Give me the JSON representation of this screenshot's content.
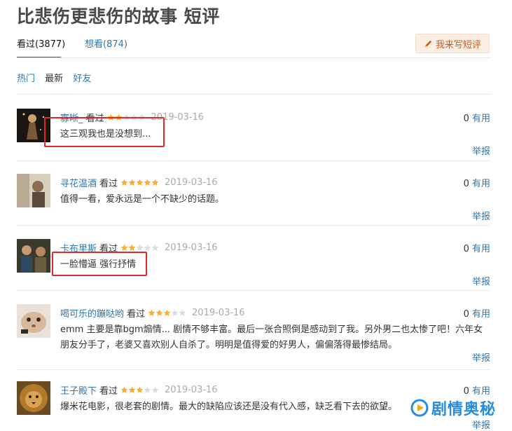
{
  "page": {
    "title": "比悲伤更悲伤的故事 短评"
  },
  "tabs": [
    {
      "label": "看过(3877)"
    },
    {
      "label": "想看(874)"
    }
  ],
  "write_button": {
    "label": "我来写短评",
    "icon": "pencil-icon"
  },
  "filters": [
    {
      "label": "热门"
    },
    {
      "label": "最新"
    },
    {
      "label": "好友"
    }
  ],
  "reviews": [
    {
      "user": "寡晰_",
      "status": "看过",
      "rating": 2,
      "date": "2019-03-16",
      "useful_count": "0",
      "useful_label": "有用",
      "content": "这三观我也是没想到...",
      "report": "举报"
    },
    {
      "user": "寻花温酒",
      "status": "看过",
      "rating": 5,
      "date": "2019-03-16",
      "useful_count": "0",
      "useful_label": "有用",
      "content": "值得一看，爱永远是一个不缺少的话题。",
      "report": "举报"
    },
    {
      "user": "卡布里斯",
      "status": "看过",
      "rating": 2,
      "date": "2019-03-16",
      "useful_count": "0",
      "useful_label": "有用",
      "content": "一脸懵逼 强行抒情",
      "report": "举报"
    },
    {
      "user": "喝可乐的蹦哒哟",
      "status": "看过",
      "rating": 3,
      "date": "2019-03-16",
      "useful_count": "0",
      "useful_label": "有用",
      "content": "emm 主要是靠bgm煽情... 剧情不够丰富。最后一张合照倒是感动到了我。另外男二也太惨了吧！六年女朋友分手了，老婆又喜欢别人自杀了。明明是值得爱的好男人，偏偏落得最惨结局。",
      "report": "举报"
    },
    {
      "user": "王子殿下",
      "status": "看过",
      "rating": 3,
      "date": "2019-03-16",
      "useful_count": "0",
      "useful_label": "有用",
      "content": "爆米花电影，很老套的剧情。最大的缺陷应该还是没有代入感，缺乏看下去的欲望。",
      "report": "举报"
    }
  ],
  "watermark": {
    "text": "剧情奥秘"
  },
  "colors": {
    "link": "#3377aa",
    "star_on": "#ffac2d",
    "star_off": "#dddddd",
    "highlight": "#e0272b",
    "watermark": "#2a8cd8"
  }
}
